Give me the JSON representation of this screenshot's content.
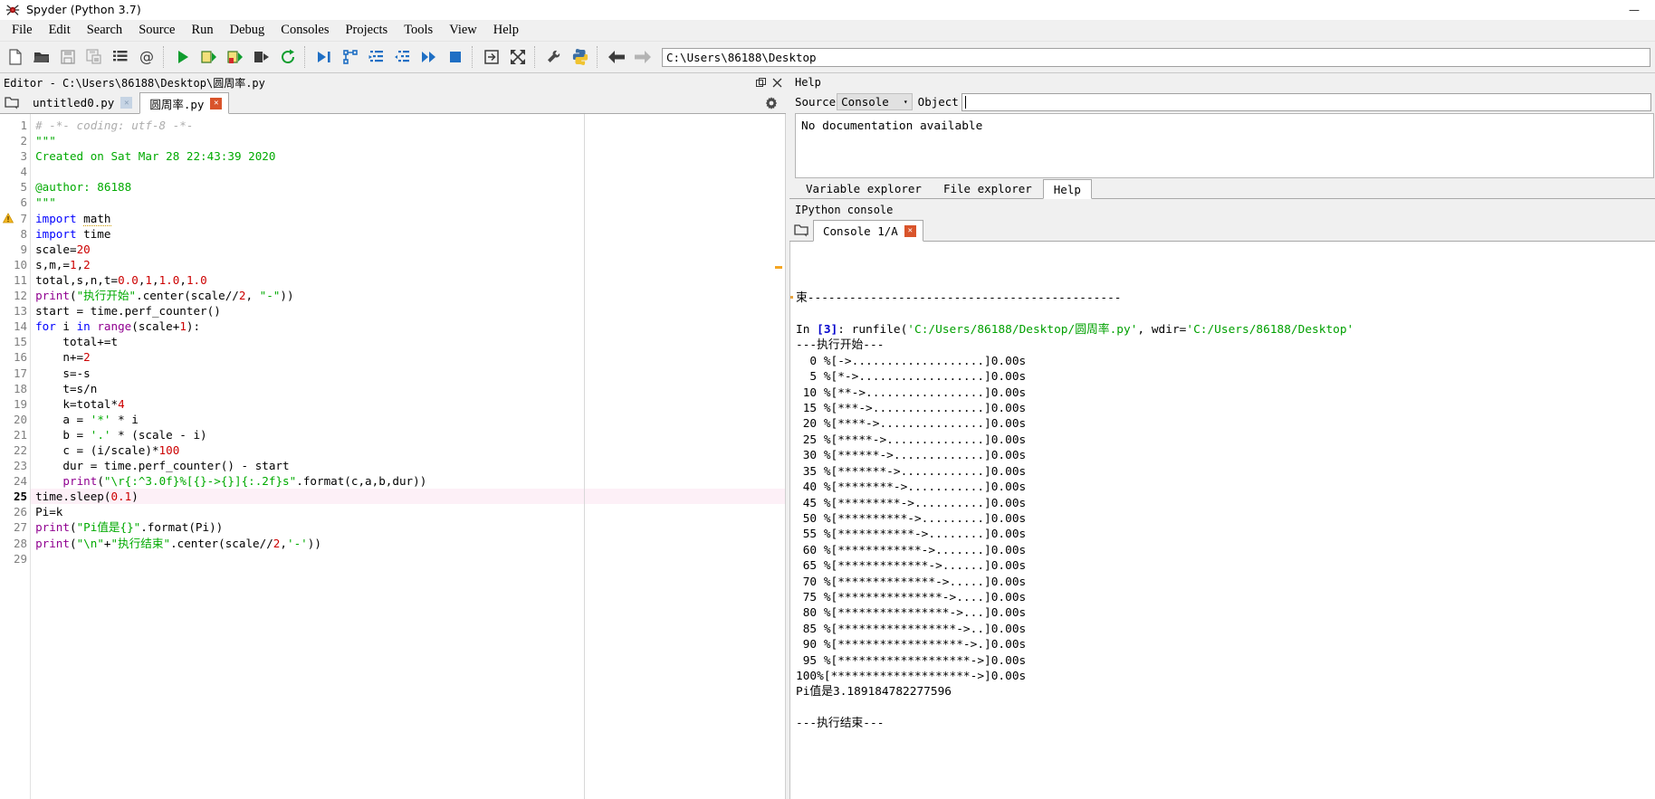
{
  "window": {
    "title": "Spyder (Python 3.7)",
    "logo_icon": "spyder-logo-icon",
    "minimize_label": "—",
    "maximize_label": "❐",
    "close_label": "✕"
  },
  "menubar": {
    "items": [
      {
        "label": "File",
        "mnemonic": "F"
      },
      {
        "label": "Edit",
        "mnemonic": "E"
      },
      {
        "label": "Search",
        "mnemonic": "S"
      },
      {
        "label": "Source",
        "mnemonic": "c"
      },
      {
        "label": "Run",
        "mnemonic": "R"
      },
      {
        "label": "Debug",
        "mnemonic": "D"
      },
      {
        "label": "Consoles",
        "mnemonic": "o"
      },
      {
        "label": "Projects",
        "mnemonic": "P"
      },
      {
        "label": "Tools",
        "mnemonic": "T"
      },
      {
        "label": "View",
        "mnemonic": "V"
      },
      {
        "label": "Help",
        "mnemonic": "H"
      }
    ]
  },
  "toolbar": {
    "buttons": [
      {
        "name": "new-file-icon",
        "title": "New file"
      },
      {
        "name": "open-file-icon",
        "title": "Open file"
      },
      {
        "name": "save-file-icon",
        "title": "Save file"
      },
      {
        "name": "save-all-icon",
        "title": "Save all"
      },
      {
        "name": "file-switcher-icon",
        "title": "File switcher"
      },
      {
        "name": "find-symbol-icon",
        "title": "Symbol finder"
      },
      {
        "name": "run-file-icon",
        "title": "Run file"
      },
      {
        "name": "run-cell-icon",
        "title": "Run cell"
      },
      {
        "name": "run-cell-advance-icon",
        "title": "Run cell and advance"
      },
      {
        "name": "run-selection-icon",
        "title": "Run selection"
      },
      {
        "name": "rerun-file-icon",
        "title": "Re-run last cell"
      },
      {
        "name": "debug-file-icon",
        "title": "Debug file"
      },
      {
        "name": "debug-step-over-icon",
        "title": "Run current line"
      },
      {
        "name": "debug-step-into-icon",
        "title": "Step into function"
      },
      {
        "name": "debug-step-return-icon",
        "title": "Run until function returns"
      },
      {
        "name": "debug-continue-icon",
        "title": "Continue execution"
      },
      {
        "name": "debug-stop-icon",
        "title": "Stop debugging"
      },
      {
        "name": "maximize-pane-icon",
        "title": "Maximize current pane"
      },
      {
        "name": "fullscreen-icon",
        "title": "Fullscreen mode"
      },
      {
        "name": "preferences-icon",
        "title": "Preferences"
      },
      {
        "name": "pythonpath-icon",
        "title": "PYTHONPATH manager"
      }
    ],
    "nav_back_icon": "arrow-back-icon",
    "nav_forward_icon": "arrow-forward-icon",
    "path_value": "C:\\Users\\86188\\Desktop"
  },
  "editor": {
    "pane_title": "Editor - C:\\Users\\86188\\Desktop\\圆周率.py",
    "undock_icon": "undock-icon",
    "close_icon": "close-icon",
    "browse_tabs_icon": "browse-tabs-icon",
    "options_icon": "gear-icon",
    "tabs": [
      {
        "label": "untitled0.py",
        "active": false,
        "close_state": "grey"
      },
      {
        "label": "圆周率.py",
        "active": true,
        "close_state": "red"
      }
    ],
    "warning_line": 7,
    "warning_icon": "warning-triangle-icon",
    "current_line": 25,
    "total_lines": 29,
    "lines": [
      {
        "n": 1,
        "tokens": [
          {
            "t": "# -*- coding: utf-8 -*-",
            "c": "cmt"
          }
        ]
      },
      {
        "n": 2,
        "tokens": [
          {
            "t": "\"\"\"",
            "c": "str"
          }
        ]
      },
      {
        "n": 3,
        "tokens": [
          {
            "t": "Created on Sat Mar 28 22:43:39 2020",
            "c": "str"
          }
        ]
      },
      {
        "n": 4,
        "tokens": []
      },
      {
        "n": 5,
        "tokens": [
          {
            "t": "@author: 86188",
            "c": "str"
          }
        ]
      },
      {
        "n": 6,
        "tokens": [
          {
            "t": "\"\"\"",
            "c": "str"
          }
        ]
      },
      {
        "n": 7,
        "tokens": [
          {
            "t": "import",
            "c": "kw"
          },
          {
            "t": " ",
            "c": ""
          },
          {
            "t": "math",
            "c": "und"
          }
        ]
      },
      {
        "n": 8,
        "tokens": [
          {
            "t": "import",
            "c": "kw"
          },
          {
            "t": " time",
            "c": ""
          }
        ]
      },
      {
        "n": 9,
        "tokens": [
          {
            "t": "scale=",
            "c": ""
          },
          {
            "t": "20",
            "c": "num"
          }
        ]
      },
      {
        "n": 10,
        "tokens": [
          {
            "t": "s,m,=",
            "c": ""
          },
          {
            "t": "1",
            "c": "num"
          },
          {
            "t": ",",
            "c": ""
          },
          {
            "t": "2",
            "c": "num"
          }
        ]
      },
      {
        "n": 11,
        "tokens": [
          {
            "t": "total,s,n,t=",
            "c": ""
          },
          {
            "t": "0.0",
            "c": "num"
          },
          {
            "t": ",",
            "c": ""
          },
          {
            "t": "1",
            "c": "num"
          },
          {
            "t": ",",
            "c": ""
          },
          {
            "t": "1.0",
            "c": "num"
          },
          {
            "t": ",",
            "c": ""
          },
          {
            "t": "1.0",
            "c": "num"
          }
        ]
      },
      {
        "n": 12,
        "tokens": [
          {
            "t": "print",
            "c": "bi"
          },
          {
            "t": "(",
            "c": ""
          },
          {
            "t": "\"执行开始\"",
            "c": "str"
          },
          {
            "t": ".center(scale//",
            "c": ""
          },
          {
            "t": "2",
            "c": "num"
          },
          {
            "t": ", ",
            "c": ""
          },
          {
            "t": "\"-\"",
            "c": "str"
          },
          {
            "t": "))",
            "c": ""
          }
        ]
      },
      {
        "n": 13,
        "tokens": [
          {
            "t": "start = time.perf_counter()",
            "c": ""
          }
        ]
      },
      {
        "n": 14,
        "tokens": [
          {
            "t": "for",
            "c": "kw"
          },
          {
            "t": " i ",
            "c": ""
          },
          {
            "t": "in",
            "c": "kw"
          },
          {
            "t": " ",
            "c": ""
          },
          {
            "t": "range",
            "c": "bi"
          },
          {
            "t": "(scale+",
            "c": ""
          },
          {
            "t": "1",
            "c": "num"
          },
          {
            "t": "):",
            "c": ""
          }
        ]
      },
      {
        "n": 15,
        "tokens": [
          {
            "t": "    total+=t",
            "c": ""
          }
        ]
      },
      {
        "n": 16,
        "tokens": [
          {
            "t": "    n+=",
            "c": ""
          },
          {
            "t": "2",
            "c": "num"
          }
        ]
      },
      {
        "n": 17,
        "tokens": [
          {
            "t": "    s=-s",
            "c": ""
          }
        ]
      },
      {
        "n": 18,
        "tokens": [
          {
            "t": "    t=s/n",
            "c": ""
          }
        ]
      },
      {
        "n": 19,
        "tokens": [
          {
            "t": "    k=total*",
            "c": ""
          },
          {
            "t": "4",
            "c": "num"
          }
        ]
      },
      {
        "n": 20,
        "tokens": [
          {
            "t": "    a = ",
            "c": ""
          },
          {
            "t": "'*'",
            "c": "str"
          },
          {
            "t": " * i",
            "c": ""
          }
        ]
      },
      {
        "n": 21,
        "tokens": [
          {
            "t": "    b = ",
            "c": ""
          },
          {
            "t": "'.'",
            "c": "str"
          },
          {
            "t": " * (scale - i)",
            "c": ""
          }
        ]
      },
      {
        "n": 22,
        "tokens": [
          {
            "t": "    c = (i/scale)*",
            "c": ""
          },
          {
            "t": "100",
            "c": "num"
          }
        ]
      },
      {
        "n": 23,
        "tokens": [
          {
            "t": "    dur = time.perf_counter() - start",
            "c": ""
          }
        ]
      },
      {
        "n": 24,
        "tokens": [
          {
            "t": "    ",
            "c": ""
          },
          {
            "t": "print",
            "c": "bi"
          },
          {
            "t": "(",
            "c": ""
          },
          {
            "t": "\"\\r{:^3.0f}%[{}->{}]{:.2f}s\"",
            "c": "str"
          },
          {
            "t": ".format(c,a,b,dur))",
            "c": ""
          }
        ]
      },
      {
        "n": 25,
        "tokens": [
          {
            "t": "time.sleep(",
            "c": ""
          },
          {
            "t": "0.1",
            "c": "num"
          },
          {
            "t": ")",
            "c": ""
          }
        ]
      },
      {
        "n": 26,
        "tokens": [
          {
            "t": "Pi=k",
            "c": ""
          }
        ]
      },
      {
        "n": 27,
        "tokens": [
          {
            "t": "print",
            "c": "bi"
          },
          {
            "t": "(",
            "c": ""
          },
          {
            "t": "\"Pi值是{}\"",
            "c": "str"
          },
          {
            "t": ".format(Pi))",
            "c": ""
          }
        ]
      },
      {
        "n": 28,
        "tokens": [
          {
            "t": "print",
            "c": "bi"
          },
          {
            "t": "(",
            "c": ""
          },
          {
            "t": "\"\\n\"",
            "c": "str"
          },
          {
            "t": "+",
            "c": ""
          },
          {
            "t": "\"执行结束\"",
            "c": "str"
          },
          {
            "t": ".center(scale//",
            "c": ""
          },
          {
            "t": "2",
            "c": "num"
          },
          {
            "t": ",",
            "c": ""
          },
          {
            "t": "'-'",
            "c": "str"
          },
          {
            "t": "))",
            "c": ""
          }
        ]
      },
      {
        "n": 29,
        "tokens": []
      }
    ]
  },
  "help": {
    "pane_title": "Help",
    "source_label": "Source",
    "source_value": "Console",
    "source_caret": "▾",
    "object_label": "Object",
    "object_value": "",
    "content": "No documentation available",
    "options_icon": "gear-icon",
    "tabs": [
      {
        "label": "Variable explorer",
        "active": false
      },
      {
        "label": "File explorer",
        "active": false
      },
      {
        "label": "Help",
        "active": true
      }
    ]
  },
  "ipython": {
    "pane_title": "IPython console",
    "browse_icon": "browse-tabs-icon",
    "tabs": [
      {
        "label": "Console 1/A",
        "active": true,
        "close_state": "red"
      }
    ],
    "output_lines": [
      {
        "segments": [
          {
            "t": "束---------------------------------------------",
            "c": ""
          }
        ]
      },
      {
        "segments": []
      },
      {
        "segments": [
          {
            "t": "In ",
            "c": ""
          },
          {
            "t": "[3]",
            "c": "cnum"
          },
          {
            "t": ": runfile(",
            "c": ""
          },
          {
            "t": "'C:/Users/86188/Desktop/圆周率.py'",
            "c": "cstr"
          },
          {
            "t": ", wdir=",
            "c": ""
          },
          {
            "t": "'C:/Users/86188/Desktop'",
            "c": "cstr"
          }
        ]
      },
      {
        "segments": [
          {
            "t": "---执行开始---",
            "c": ""
          }
        ]
      },
      {
        "segments": [
          {
            "t": "  0 %[->...................]0.00s",
            "c": ""
          }
        ]
      },
      {
        "segments": [
          {
            "t": "  5 %[*->..................]0.00s",
            "c": ""
          }
        ]
      },
      {
        "segments": [
          {
            "t": " 10 %[**->.................]0.00s",
            "c": ""
          }
        ]
      },
      {
        "segments": [
          {
            "t": " 15 %[***->................]0.00s",
            "c": ""
          }
        ]
      },
      {
        "segments": [
          {
            "t": " 20 %[****->...............]0.00s",
            "c": ""
          }
        ]
      },
      {
        "segments": [
          {
            "t": " 25 %[*****->..............]0.00s",
            "c": ""
          }
        ]
      },
      {
        "segments": [
          {
            "t": " 30 %[******->.............]0.00s",
            "c": ""
          }
        ]
      },
      {
        "segments": [
          {
            "t": " 35 %[*******->............]0.00s",
            "c": ""
          }
        ]
      },
      {
        "segments": [
          {
            "t": " 40 %[********->...........]0.00s",
            "c": ""
          }
        ]
      },
      {
        "segments": [
          {
            "t": " 45 %[*********->..........]0.00s",
            "c": ""
          }
        ]
      },
      {
        "segments": [
          {
            "t": " 50 %[**********->.........]0.00s",
            "c": ""
          }
        ]
      },
      {
        "segments": [
          {
            "t": " 55 %[***********->........]0.00s",
            "c": ""
          }
        ]
      },
      {
        "segments": [
          {
            "t": " 60 %[************->.......]0.00s",
            "c": ""
          }
        ]
      },
      {
        "segments": [
          {
            "t": " 65 %[*************->......]0.00s",
            "c": ""
          }
        ]
      },
      {
        "segments": [
          {
            "t": " 70 %[**************->.....]0.00s",
            "c": ""
          }
        ]
      },
      {
        "segments": [
          {
            "t": " 75 %[***************->....]0.00s",
            "c": ""
          }
        ]
      },
      {
        "segments": [
          {
            "t": " 80 %[****************->...]0.00s",
            "c": ""
          }
        ]
      },
      {
        "segments": [
          {
            "t": " 85 %[*****************->..]0.00s",
            "c": ""
          }
        ]
      },
      {
        "segments": [
          {
            "t": " 90 %[******************->.]0.00s",
            "c": ""
          }
        ]
      },
      {
        "segments": [
          {
            "t": " 95 %[*******************->]0.00s",
            "c": ""
          }
        ]
      },
      {
        "segments": [
          {
            "t": "100%[********************->]0.00s",
            "c": ""
          }
        ]
      },
      {
        "segments": [
          {
            "t": "Pi值是3.189184782277596",
            "c": ""
          }
        ]
      },
      {
        "segments": []
      },
      {
        "segments": [
          {
            "t": "---执行结束---",
            "c": ""
          }
        ]
      }
    ]
  },
  "colors": {
    "chrome": "#f0f0f0",
    "editor_bg": "#ffffff",
    "keyword": "#0000ff",
    "builtin": "#900090",
    "string": "#00aa00",
    "number": "#cc0000",
    "comment": "#adadad",
    "current_line": "#fdf0f7",
    "close_red": "#d9542b",
    "warning": "#f5a623"
  }
}
